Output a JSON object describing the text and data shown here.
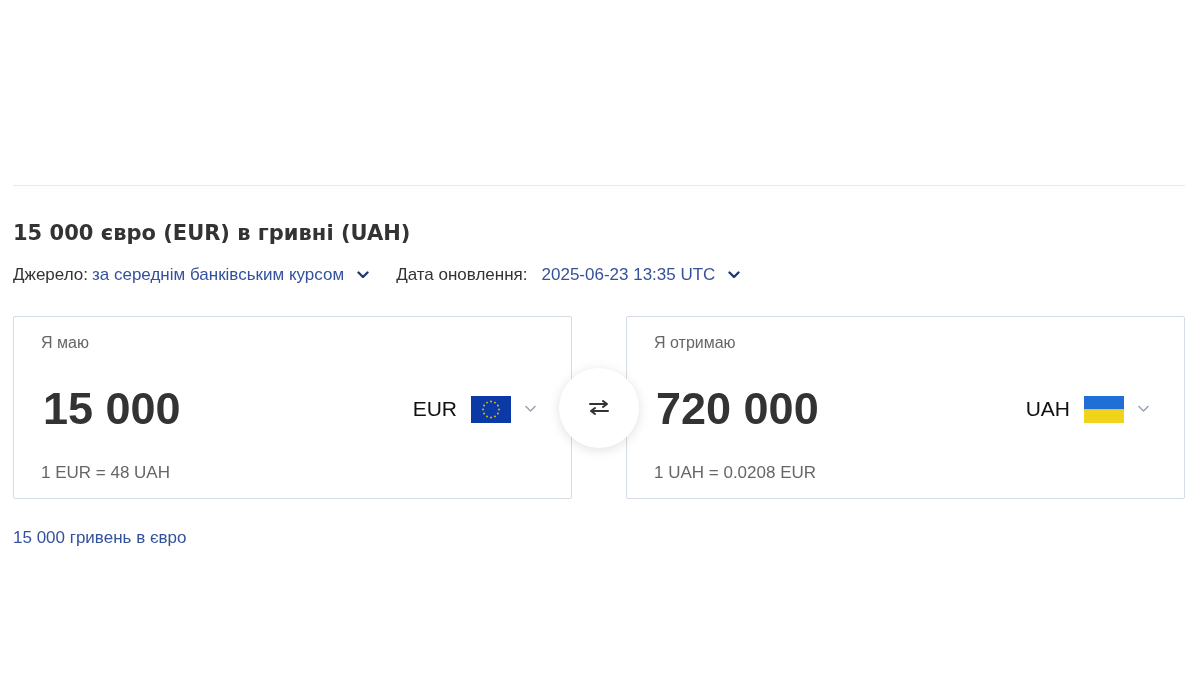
{
  "title": "15 000 євро (EUR) в гривні (UAH)",
  "source": {
    "label": "Джерело:",
    "value": "за середнім банківським курсом"
  },
  "updated": {
    "label": "Дата оновлення:",
    "value": "2025-06-23 13:35 UTC"
  },
  "converter": {
    "cards": [
      {
        "label": "Я маю",
        "amount": "15 000",
        "currency": "EUR",
        "flag": {
          "kind": "eu"
        },
        "rate": "1 EUR = 48 UAH"
      },
      {
        "label": "Я отримаю",
        "amount": "720 000",
        "currency": "UAH",
        "flag": {
          "kind": "ua"
        },
        "rate": "1 UAH = 0.0208 EUR"
      }
    ]
  },
  "links": [
    "15 000 гривень в євро"
  ]
}
